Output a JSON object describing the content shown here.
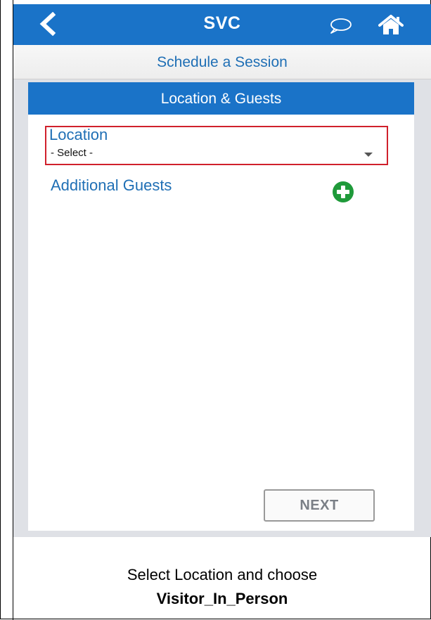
{
  "header": {
    "title": "SVC",
    "back_icon": "chevron-left-icon",
    "chat_icon": "chat-bubble-icon",
    "home_icon": "home-icon"
  },
  "subheader": {
    "title": "Schedule a Session"
  },
  "panel": {
    "title": "Location & Guests",
    "location": {
      "label": "Location",
      "value": "- Select -"
    },
    "guests": {
      "label": "Additional Guests",
      "add_icon": "plus-circle-icon"
    },
    "next_label": "NEXT"
  },
  "caption": {
    "line1": "Select Location and choose",
    "line2": "Visitor_In_Person"
  },
  "colors": {
    "primary": "#1a73c8",
    "text_blue": "#1f6fb5",
    "highlight_red": "#d0202c",
    "add_green": "#1f9a3a",
    "background": "#dfe1e6"
  }
}
